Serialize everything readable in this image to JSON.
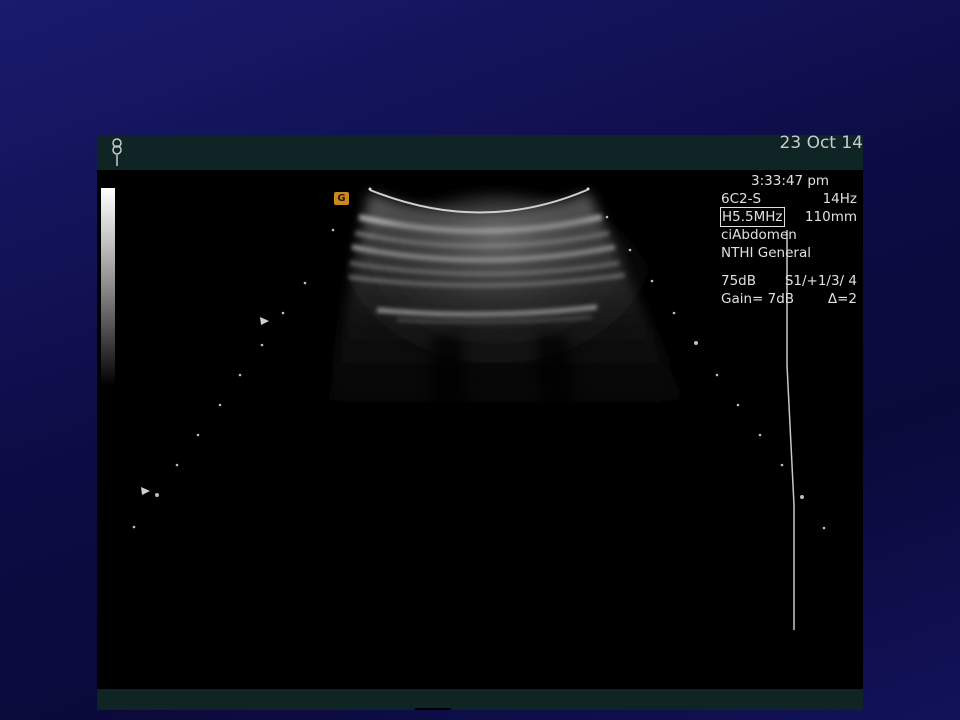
{
  "header": {
    "date": "23 Oct 14",
    "probe_icon": "probe-orientation-icon"
  },
  "params": {
    "time": "3:33:47 pm",
    "transducer": "6C2-S",
    "frame_rate": "14Hz",
    "frequency": "H5.5MHz",
    "depth": "110mm",
    "preset": "ciAbdomen",
    "institution": "NTHI General",
    "dynamic_range": "75dB",
    "processing": "S1/+1/3/ 4",
    "gain": "Gain= 7dB",
    "delta": "Δ=2"
  },
  "focus_marker_label": "G",
  "colors": {
    "background": "#0c0c45",
    "screen": "#000000",
    "bar": "#0f2424",
    "text": "#e0e0e0",
    "marker": "#c98a1e"
  }
}
